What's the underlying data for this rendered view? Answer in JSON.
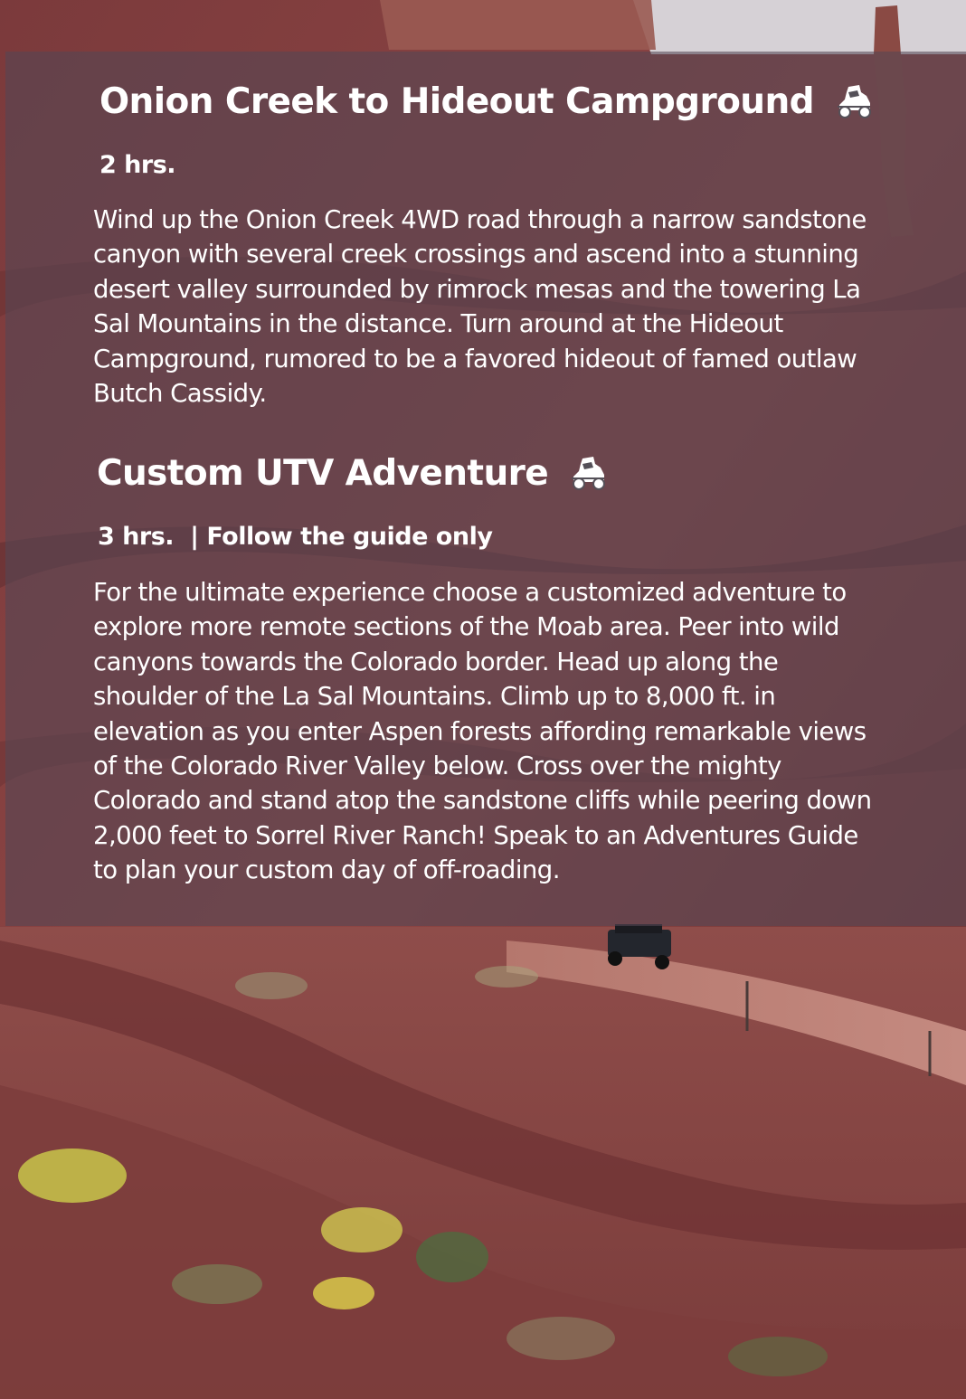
{
  "tours": [
    {
      "title": "Onion Creek to Hideout Campground",
      "icon": "utv-vehicle-icon",
      "duration": "2 hrs.",
      "note": "",
      "description": "Wind up the Onion Creek 4WD road through a narrow sandstone canyon with several creek crossings and ascend into a stunning desert valley surrounded by rimrock mesas and the towering La Sal Mountains in the distance. Turn around at the Hideout Campground, rumored to be a favored hideout of famed outlaw Butch Cassidy."
    },
    {
      "title": "Custom UTV Adventure",
      "icon": "utv-vehicle-icon",
      "duration": "3 hrs.",
      "note": "| Follow the guide only",
      "description": "For the ultimate experience choose a customized adventure to explore more remote sections of the Moab area. Peer into wild canyons towards the Colorado border. Head up along the shoulder of the La Sal Mountains. Climb up to 8,000 ft. in elevation as you enter Aspen forests affording remarkable views of the Colorado River Valley below. Cross over the mighty Colorado and stand atop the sandstone cliffs while peering down 2,000 feet to Sorrel River Ranch! Speak to an Adventures Guide to plan your custom day of off-roading."
    }
  ],
  "colors": {
    "overlay": "#544654",
    "text": "#ffffff",
    "canyon_red": "#8c3f3a",
    "sky": "#d9d4d8"
  }
}
